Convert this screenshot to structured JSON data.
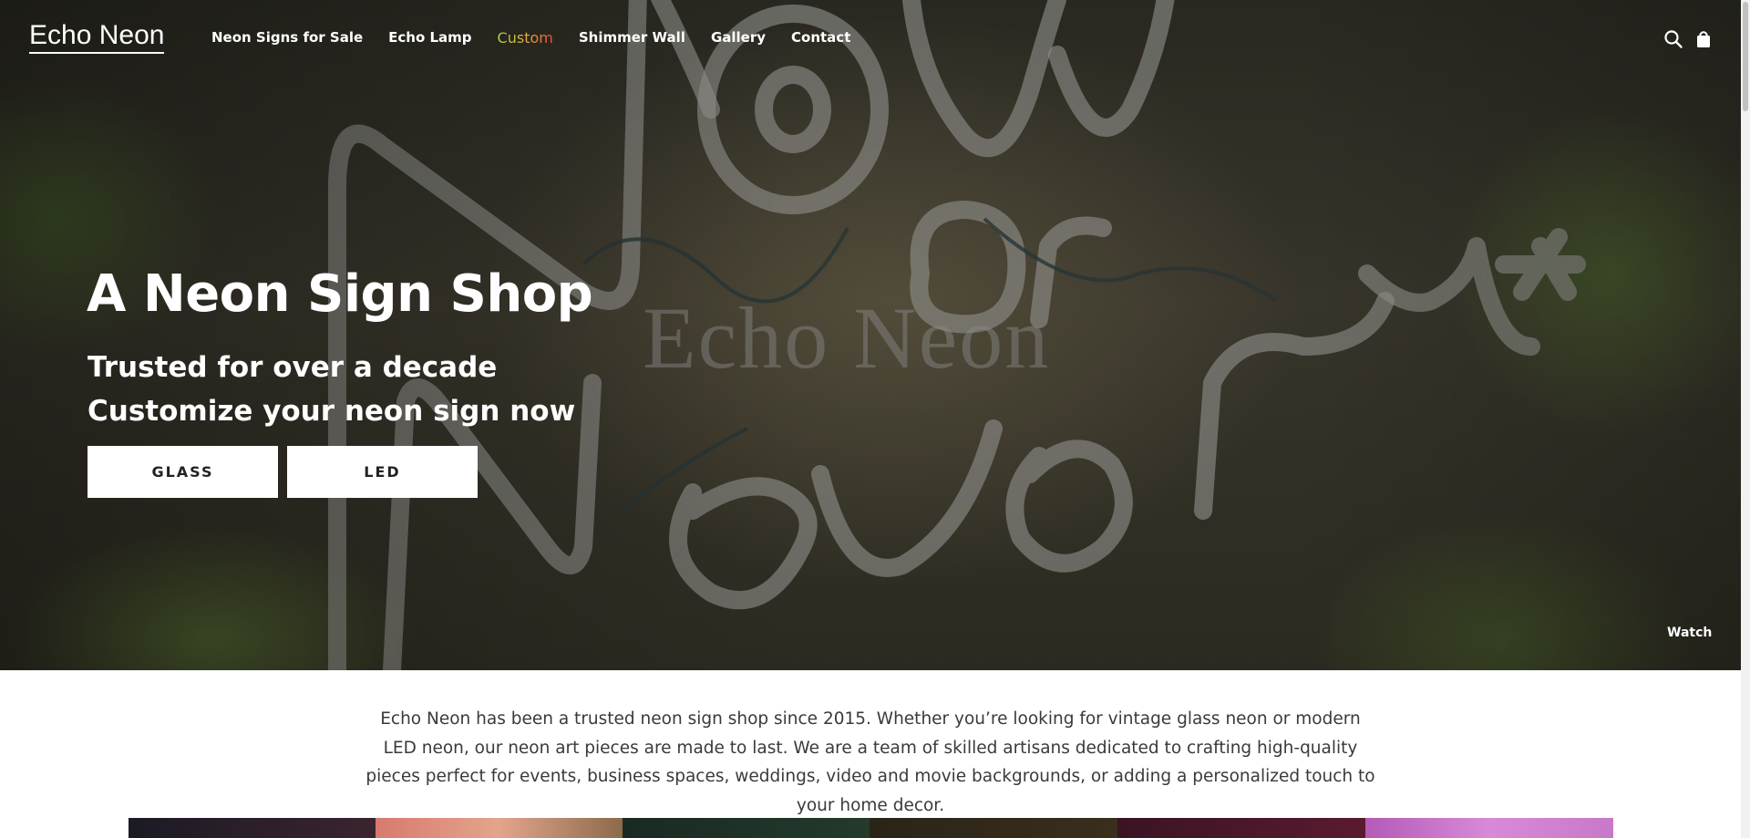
{
  "brand": {
    "logo": "Echo Neon"
  },
  "nav": {
    "items": [
      {
        "label": "Neon Signs for Sale"
      },
      {
        "label": "Echo Lamp"
      },
      {
        "label": "Custom"
      },
      {
        "label": "Shimmer Wall"
      },
      {
        "label": "Gallery"
      },
      {
        "label": "Contact"
      }
    ]
  },
  "header_icons": [
    "search-icon",
    "shopping-bag-icon"
  ],
  "hero": {
    "watermark": "Echo Neon",
    "title": "A Neon Sign Shop",
    "subtitle_1": "Trusted for over a decade",
    "subtitle_2": "Customize your neon sign now",
    "buttons": {
      "glass": "GLASS",
      "led": "LED"
    },
    "watch_label": "Watch"
  },
  "intro": {
    "text": "Echo Neon has been a trusted neon sign shop since 2015. Whether you’re looking for vintage glass neon or modern LED neon, our neon art pieces are made to last. We are a team of skilled artisans dedicated to crafting high-quality pieces perfect for events, business spaces, weddings, video and movie backgrounds, or adding a personalized touch to your home decor."
  },
  "colors": {
    "nav_custom_gradient": [
      "#a8d24a",
      "#e0b040",
      "#e84a3c"
    ],
    "text_dark": "#3a3a3a",
    "white": "#ffffff"
  }
}
